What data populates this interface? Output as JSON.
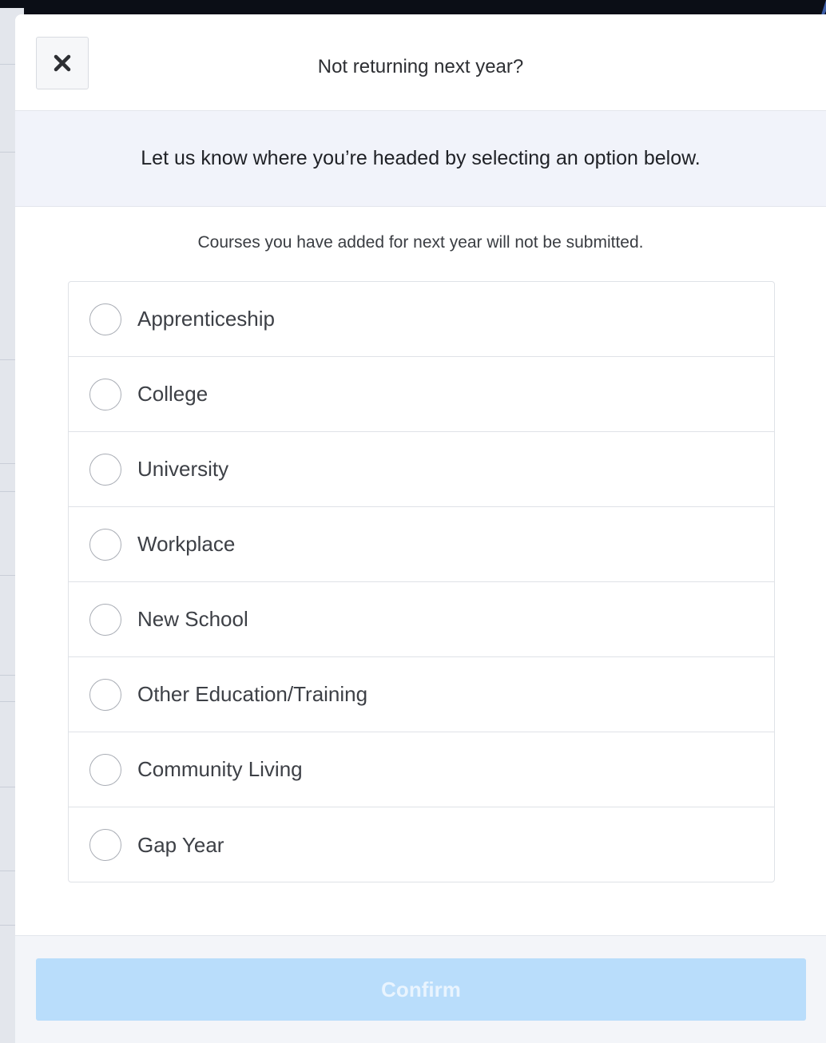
{
  "dialog": {
    "title": "Not returning next year?",
    "close_icon": "close-icon",
    "prompt": "Let us know where you’re headed by selecting an option below.",
    "notice": "Courses you have added for next year will not be submitted.",
    "options": [
      {
        "label": "Apprenticeship",
        "selected": false
      },
      {
        "label": "College",
        "selected": false
      },
      {
        "label": "University",
        "selected": false
      },
      {
        "label": "Workplace",
        "selected": false
      },
      {
        "label": "New School",
        "selected": false
      },
      {
        "label": "Other Education/Training",
        "selected": false
      },
      {
        "label": "Community Living",
        "selected": false
      },
      {
        "label": "Gap Year",
        "selected": false
      }
    ],
    "confirm_label": "Confirm",
    "confirm_enabled": false
  },
  "colors": {
    "confirm_disabled_bg": "#b9ddfb",
    "banner_bg": "#f1f3fa",
    "backdrop": "#0b0e16"
  }
}
